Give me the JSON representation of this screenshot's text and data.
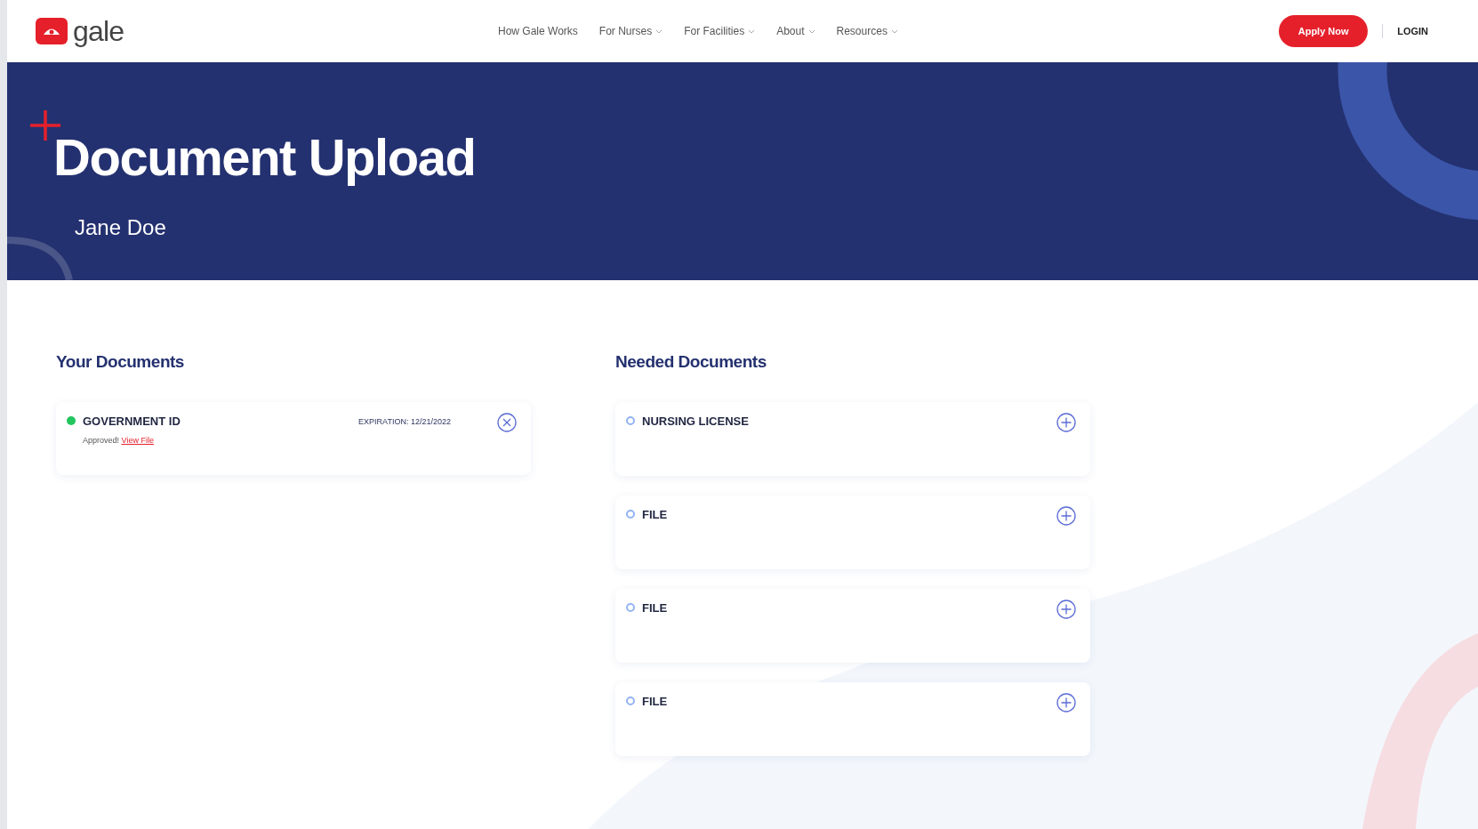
{
  "header": {
    "logo_text": "gale",
    "nav": [
      {
        "label": "How Gale Works",
        "has_menu": false
      },
      {
        "label": "For Nurses",
        "has_menu": true
      },
      {
        "label": "For Facilities",
        "has_menu": true
      },
      {
        "label": "About",
        "has_menu": true
      },
      {
        "label": "Resources",
        "has_menu": true
      }
    ],
    "apply_button": "Apply Now",
    "login": "LOGIN"
  },
  "hero": {
    "title": "Document Upload",
    "subtitle": "Jane Doe"
  },
  "your_documents": {
    "heading": "Your Documents",
    "items": [
      {
        "approved": true,
        "name": "GOVERNMENT ID",
        "expiration": "EXPIRATION: 12/21/2022",
        "note": "Approved!",
        "link": "View File"
      }
    ]
  },
  "needed_documents": {
    "heading": "Needed Documents",
    "items": [
      {
        "approved": false,
        "name": "NURSING LICENSE"
      },
      {
        "approved": false,
        "name": "FILE"
      },
      {
        "approved": false,
        "name": "FILE"
      },
      {
        "approved": false,
        "name": "FILE"
      }
    ]
  }
}
